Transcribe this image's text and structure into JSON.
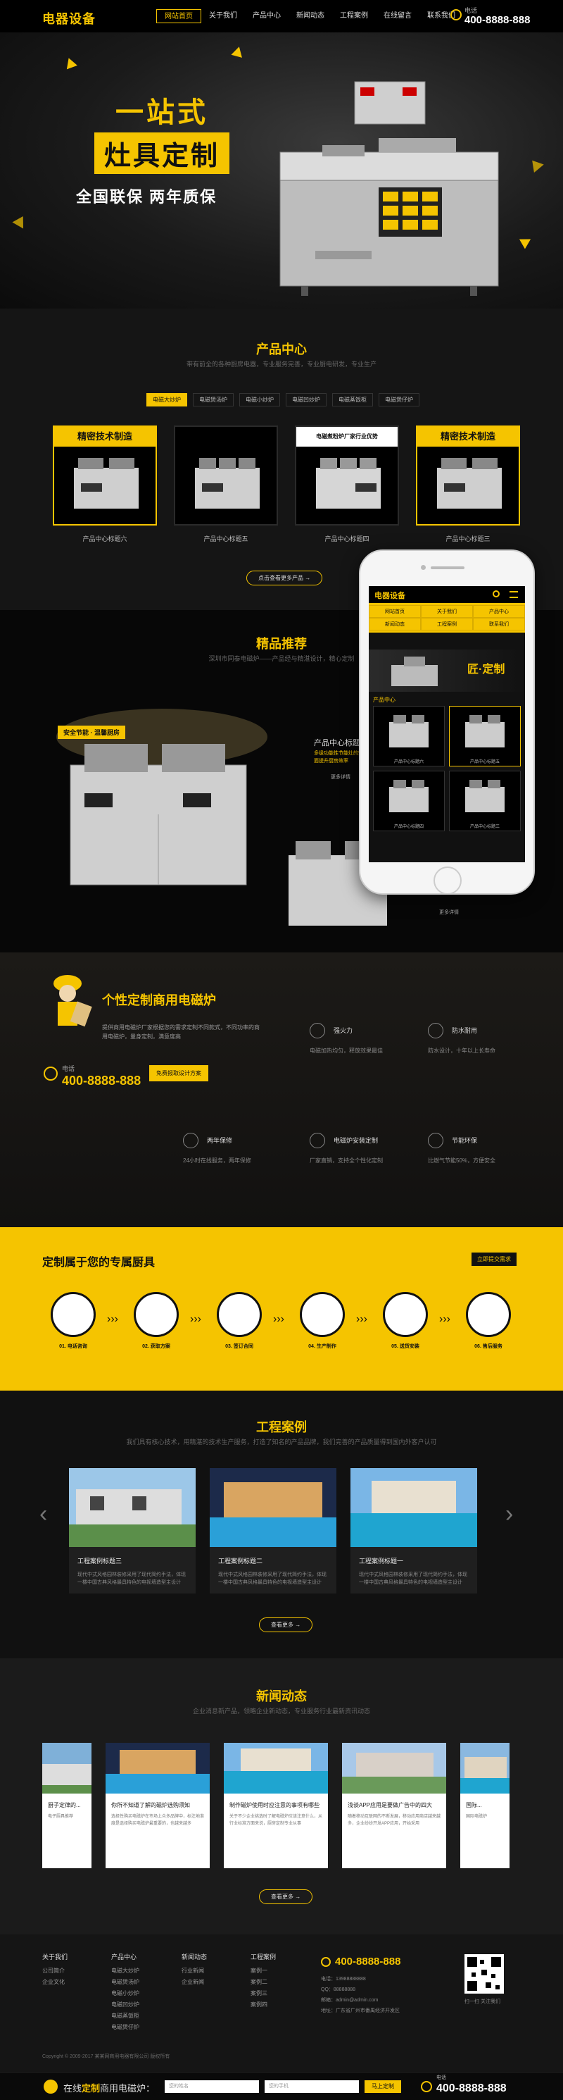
{
  "header": {
    "logo": "电器设备",
    "nav": [
      "网站首页",
      "关于我们",
      "产品中心",
      "新闻动态",
      "工程案例",
      "在线留言",
      "联系我们"
    ],
    "phone_label": "电话",
    "phone": "400-8888-888"
  },
  "banner": {
    "title_line1": "一站式",
    "title_line2": "灶具定制",
    "subtitle": "全国联保  两年质保"
  },
  "products": {
    "title": "产品中心",
    "desc": "带有前全的各种厨房电器，专业服务完善，专业厨电研发，专业生产",
    "tabs": [
      "电磁大炒炉",
      "电磁煲汤炉",
      "电磁小炒炉",
      "电磁凹炒炉",
      "电磁蒸饭柜",
      "电磁煲仔炉"
    ],
    "items": [
      {
        "badge": "精密技术制造",
        "name": "产品中心标题六"
      },
      {
        "badge": "",
        "name": "产品中心标题五"
      },
      {
        "badge": "电磁煮粉炉厂家行业优势",
        "name": "产品中心标题四"
      },
      {
        "badge": "精密技术制造",
        "name": "产品中心标题三"
      }
    ],
    "more": "点击查看更多产品 →"
  },
  "recommend": {
    "title": "精品推荐",
    "desc": "深圳市同泰电磁炉——产品经与精湛设计，精心定制",
    "tag": "安全节能 · 温馨厨房",
    "item_title": "产品中心标题六",
    "item_desc": "多级功能性节能灶的完善设施，全面提升厨房效率",
    "more": "更多详情",
    "more2": "更多详情"
  },
  "phone_mockup": {
    "logo": "电器设备",
    "menu": [
      "网站首页",
      "关于我们",
      "产品中心",
      "新闻动态",
      "工程案例",
      "联系我们"
    ],
    "banner_text": "匠·定制",
    "section": "产品中心",
    "items": [
      "产品中心标题六",
      "产品中心标题五",
      "产品中心标题四",
      "产品中心标题三"
    ]
  },
  "custom": {
    "title": "个性定制商用电磁炉",
    "text": "提供商用电磁炉厂家根据您的需求定制不同款式，不同功率的商用电磁炉，量身定制，满意度高",
    "phone_label": "电话",
    "phone": "400-8888-888",
    "button": "免费报取设计方案",
    "features": [
      {
        "title": "强火力",
        "desc": "电磁加热均匀，释放效果最佳"
      },
      {
        "title": "防水耐用",
        "desc": "防水设计，十年以上长寿命"
      },
      {
        "title": "两年保修",
        "desc": "24小时在线服务，两年保修"
      },
      {
        "title": "电磁炉安装定制",
        "desc": "厂家直销，支持全个性化定制"
      },
      {
        "title": "节能环保",
        "desc": "比燃气节能50%，方便安全"
      }
    ]
  },
  "process": {
    "title": "定制属于您的专属厨具",
    "button": "立即提交需求",
    "steps": [
      "01. 电话咨询",
      "02. 获取方案",
      "03. 签订合同",
      "04. 生产制作",
      "05. 送货安装",
      "06. 售后服务"
    ]
  },
  "cases": {
    "title": "工程案例",
    "desc": "我们具有核心技术，用精湛的技术生产服务，打造了知名的产品品牌，我们完善的产品质量得到国内外客户认可",
    "items": [
      {
        "title": "工程案例标题三",
        "desc": "现代中式风格园林装修采用了现代简约手法，体现一楼中国古典风格最具特色的电视墙造型主设计"
      },
      {
        "title": "工程案例标题二",
        "desc": "现代中式风格园林装修采用了现代简约手法，体现一楼中国古典风格最具特色的电视墙造型主设计"
      },
      {
        "title": "工程案例标题一",
        "desc": "现代中式风格园林装修采用了现代简约手法，体现一楼中国古典风格最具特色的电视墙造型主设计"
      }
    ],
    "more": "查看更多 →"
  },
  "news": {
    "title": "新闻动态",
    "desc": "企业消息新产品，领略企业新动态，专业服务行业最新资讯动态",
    "items": [
      {
        "title": "厨子定律的...",
        "desc": "电子厨具推荐"
      },
      {
        "title": "你所不知道了解的磁炉选购须知",
        "desc": "选择性购买电磁炉在市场上众多品牌中，标注地准度是选择购买电磁炉最重要的，也越来越多"
      },
      {
        "title": "制作磁炉使用时应注意的事项有哪些",
        "desc": "关于不少企业挑选时了解电磁炉应该注意什么，从行业标准方面来说，厨房定制专业从事"
      },
      {
        "title": "浅谈APP应用是要做广告中的四大",
        "desc": "随着移动互联网的不断发展，移动应用商店越来越多，企业纷纷开发APP应用，开始采用"
      },
      {
        "title": "国际...",
        "desc": "国际电磁炉"
      }
    ],
    "more": "查看更多 →"
  },
  "footer": {
    "cols": [
      {
        "head": "关于我们",
        "items": [
          "公司简介",
          "企业文化"
        ]
      },
      {
        "head": "产品中心",
        "items": [
          "电磁大炒炉",
          "电磁煲汤炉",
          "电磁小炒炉",
          "电磁凹炒炉",
          "电磁蒸饭柜",
          "电磁煲仔炉"
        ]
      },
      {
        "head": "新闻动态",
        "items": [
          "行业新闻",
          "企业新闻"
        ]
      },
      {
        "head": "工程案例",
        "items": [
          "案例一",
          "案例二",
          "案例三",
          "案例四"
        ]
      }
    ],
    "phone": "400-8888-888",
    "info": [
      "电话：13988888888",
      "QQ：88888888",
      "邮箱：admin@admin.com",
      "地址：广东省广州市番禺经济开发区"
    ],
    "qr_caption": "扫一扫 关注我们",
    "copyright": "Copyright © 2009-2017 某某网商用电器有限公司 版权所有"
  },
  "bottombar": {
    "text_prefix": "在线",
    "text_em": "定制",
    "text_suffix": "商用电磁炉：",
    "name_ph": "您的姓名",
    "phone_ph": "您的手机",
    "area_ph": "请输入所在地区",
    "button": "马上定制",
    "phone_label": "电话",
    "phone": "400-8888-888"
  },
  "colors": {
    "accent": "#f5c400",
    "dark": "#111111"
  }
}
